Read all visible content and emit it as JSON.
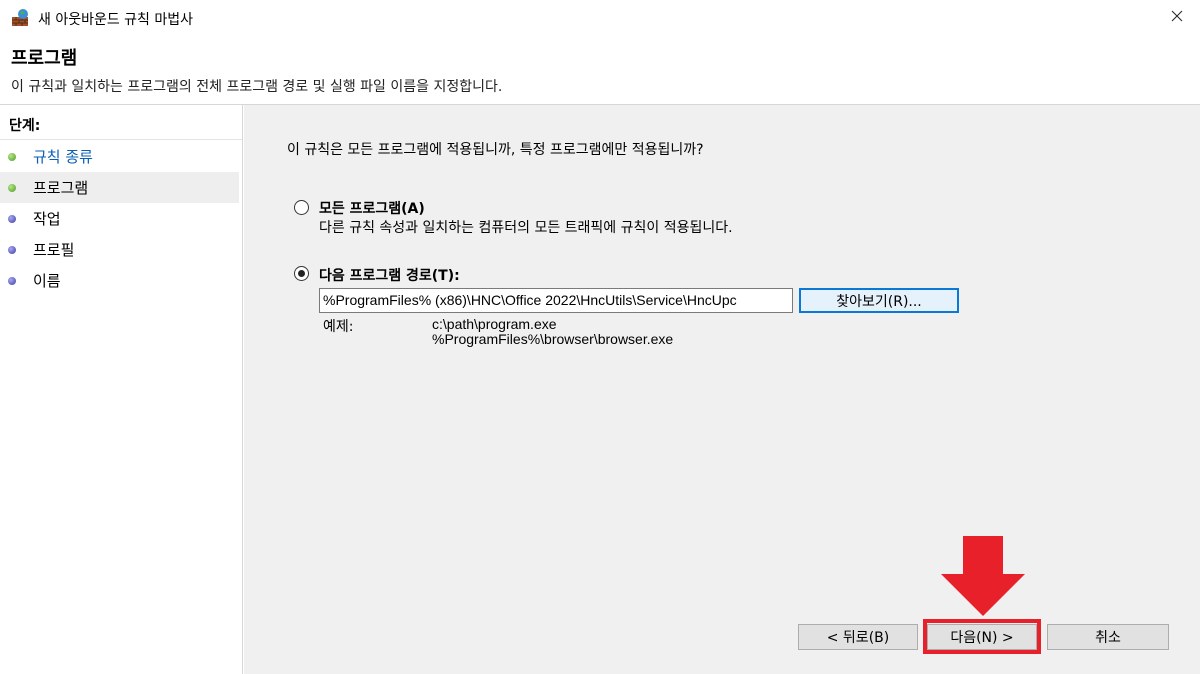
{
  "window": {
    "title": "새 아웃바운드 규칙 마법사",
    "icon": "firewall-wizard-icon",
    "close_icon": "close-icon"
  },
  "header": {
    "title": "프로그램",
    "description": "이 규칙과 일치하는 프로그램의 전체 프로그램 경로 및 실행 파일 이름을 지정합니다."
  },
  "sidebar": {
    "steps_label": "단계:",
    "items": [
      {
        "label": "규칙 종류",
        "state": "done"
      },
      {
        "label": "프로그램",
        "state": "current"
      },
      {
        "label": "작업",
        "state": "pending"
      },
      {
        "label": "프로필",
        "state": "pending"
      },
      {
        "label": "이름",
        "state": "pending"
      }
    ]
  },
  "main": {
    "question": "이 규칙은 모든 프로그램에 적용됩니까, 특정 프로그램에만 적용됩니까?",
    "option_all": {
      "label": "모든 프로그램(A)",
      "description": "다른 규칙 속성과 일치하는 컴퓨터의 모든 트래픽에 규칙이 적용됩니다."
    },
    "option_path": {
      "label": "다음 프로그램 경로(T):",
      "value": "%ProgramFiles% (x86)\\HNC\\Office 2022\\HncUtils\\Service\\HncUpc",
      "browse_label": "찾아보기(R)..."
    },
    "example": {
      "label": "예제:",
      "lines": [
        "c:\\path\\program.exe",
        "%ProgramFiles%\\browser\\browser.exe"
      ]
    }
  },
  "footer": {
    "back_label": "< 뒤로(B)",
    "next_label": "다음(N) >",
    "cancel_label": "취소"
  },
  "colors": {
    "accent": "#0a78d7",
    "highlight": "#e8202a",
    "panel_bg": "#f0f0f0"
  }
}
